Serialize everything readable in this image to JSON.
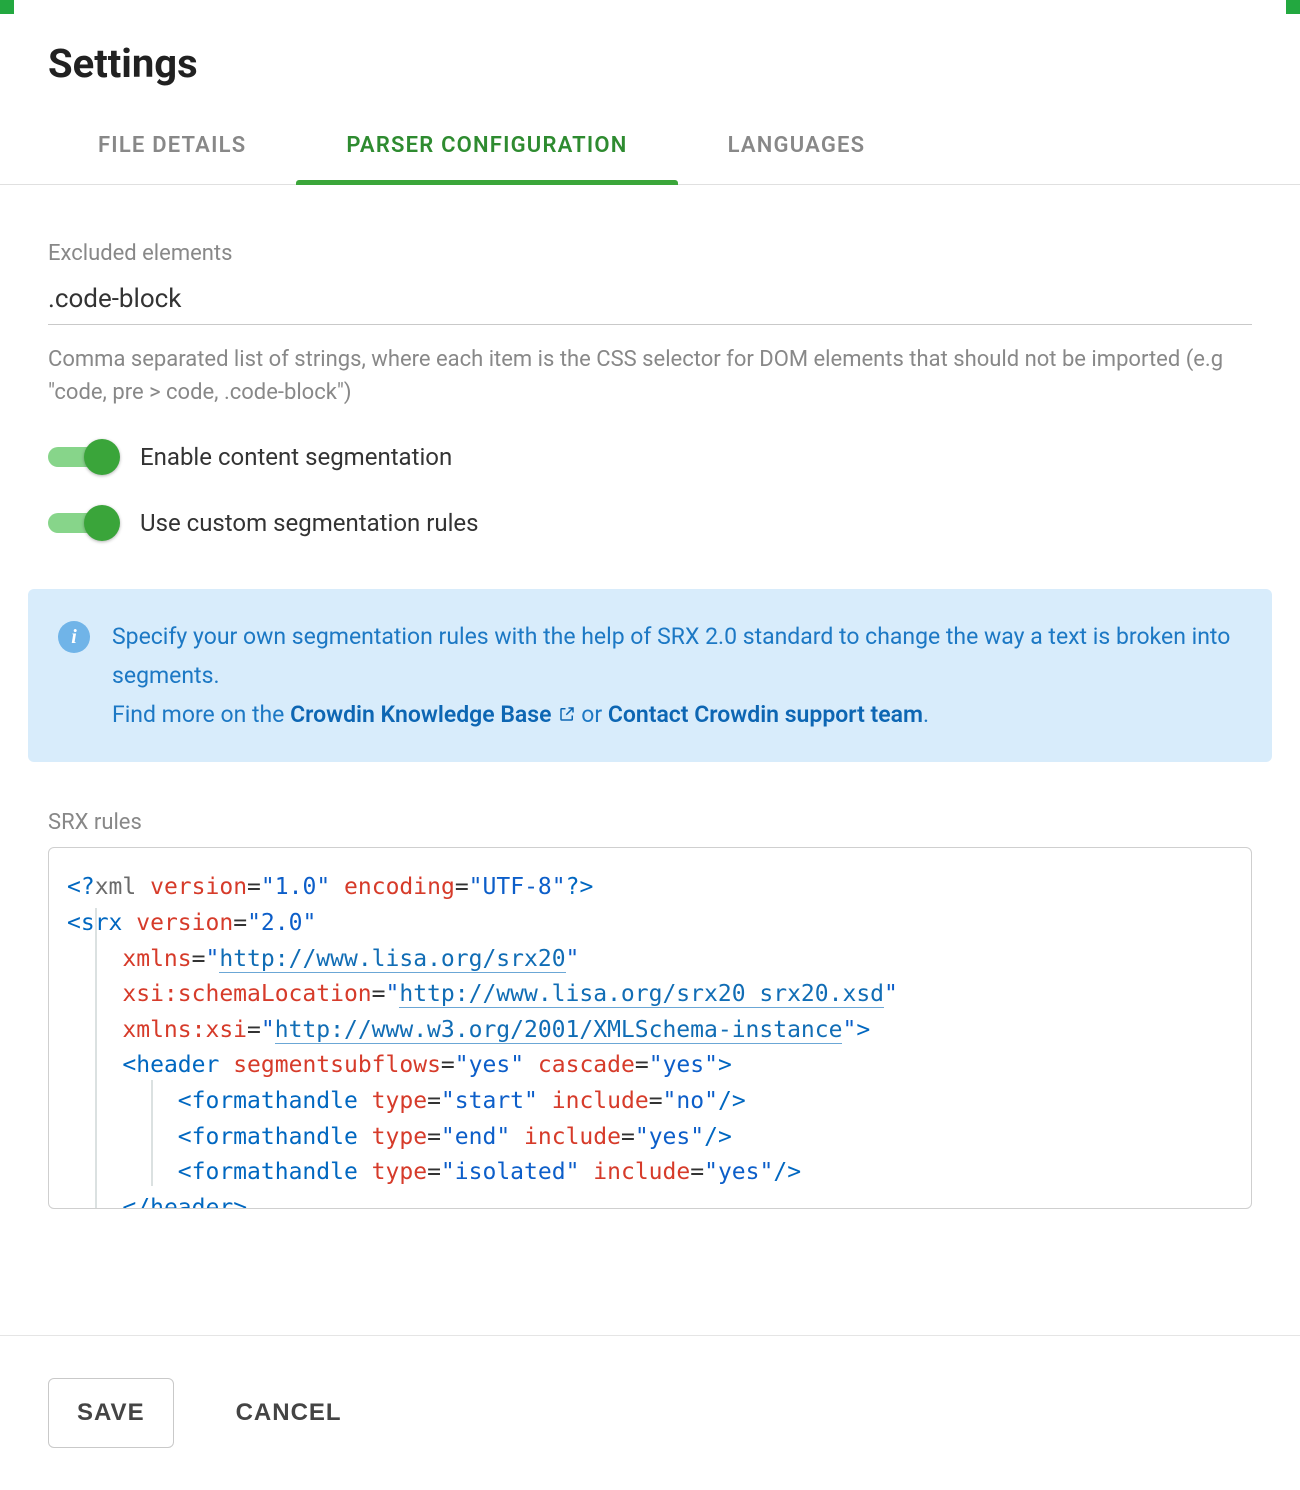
{
  "title": "Settings",
  "tabs": [
    "FILE DETAILS",
    "PARSER CONFIGURATION",
    "LANGUAGES"
  ],
  "activeTabIndex": 1,
  "form": {
    "excludedElements": {
      "label": "Excluded elements",
      "value": ".code-block",
      "helper": "Comma separated list of strings, where each item is the CSS selector for DOM elements that should not be imported (e.g \"code, pre > code, .code-block\")"
    },
    "toggles": {
      "enableSegmentation": {
        "label": "Enable content segmentation",
        "checked": true
      },
      "customRules": {
        "label": "Use custom segmentation rules",
        "checked": true
      }
    },
    "info": {
      "line1": "Specify your own segmentation rules with the help of SRX 2.0 standard to change the way a text is broken into segments.",
      "line2_prefix": "Find more on the ",
      "link1": "Crowdin Knowledge Base",
      "line2_mid": " or ",
      "link2": "Contact Crowdin support team",
      "line2_suffix": "."
    },
    "srx": {
      "label": "SRX rules",
      "xml": {
        "version": "1.0",
        "encoding": "UTF-8",
        "srxVersion": "2.0",
        "xmlns": "http://www.lisa.org/srx20",
        "schemaLocation": "http://www.lisa.org/srx20 srx20.xsd",
        "xmlnsXsi": "http://www.w3.org/2001/XMLSchema-instance",
        "header": {
          "segmentsubflows": "yes",
          "cascade": "yes",
          "formathandles": [
            {
              "type": "start",
              "include": "no"
            },
            {
              "type": "end",
              "include": "yes"
            },
            {
              "type": "isolated",
              "include": "yes"
            }
          ]
        }
      }
    }
  },
  "footer": {
    "save": "SAVE",
    "cancel": "CANCEL"
  }
}
